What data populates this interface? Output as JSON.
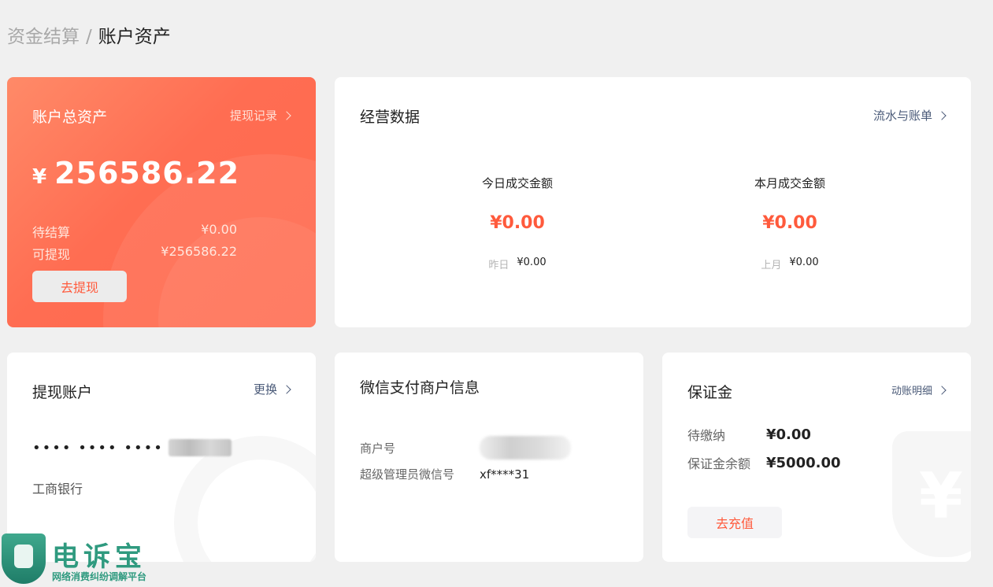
{
  "breadcrumb": {
    "parent": "资金结算",
    "separator": "/",
    "current": "账户资产"
  },
  "asset_card": {
    "title": "账户总资产",
    "link": "提现记录",
    "currency_symbol": "¥",
    "total": "256586.22",
    "pending_label": "待结算",
    "pending_value": "¥0.00",
    "withdrawable_label": "可提现",
    "withdrawable_value": "¥256586.22",
    "button": "去提现"
  },
  "ops_card": {
    "title": "经营数据",
    "link": "流水与账单",
    "today": {
      "label": "今日成交金额",
      "value": "¥0.00",
      "sub_label": "昨日",
      "sub_value": "¥0.00"
    },
    "month": {
      "label": "本月成交金额",
      "value": "¥0.00",
      "sub_label": "上月",
      "sub_value": "¥0.00"
    }
  },
  "account_card": {
    "title": "提现账户",
    "link": "更换",
    "card_mask": "•••• •••• ••••",
    "bank": "工商银行"
  },
  "wechat_card": {
    "title": "微信支付商户信息",
    "merchant_id_label": "商户号",
    "admin_label": "超级管理员微信号",
    "admin_value": "xf****31"
  },
  "deposit_card": {
    "title": "保证金",
    "link": "动账明细",
    "due_label": "待缴纳",
    "due_value": "¥0.00",
    "balance_label": "保证金余额",
    "balance_value": "¥5000.00",
    "button": "去充值"
  },
  "watermark": {
    "brand": "电诉宝",
    "tagline": "网络消费纠纷调解平台"
  },
  "colors": {
    "accent": "#ff5a3c",
    "card_gradient_start": "#ff8a68",
    "card_gradient_end": "#ff6a4e",
    "link": "#4a5a78"
  }
}
